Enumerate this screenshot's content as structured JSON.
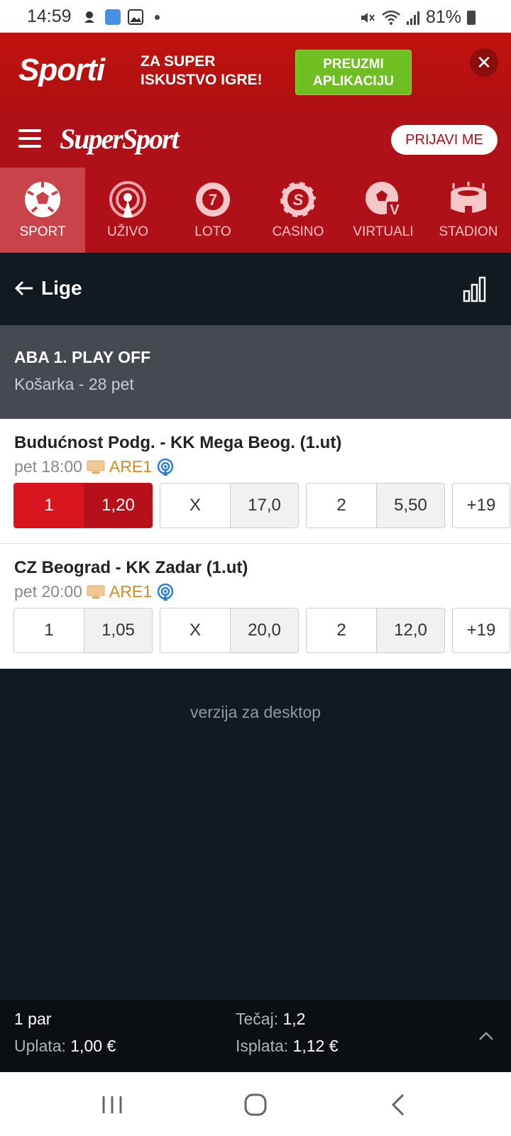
{
  "status": {
    "time": "14:59",
    "battery": "81%"
  },
  "promo": {
    "brand": "Sporti",
    "tagline": "ZA SUPER ISKUSTVO IGRE!",
    "cta": "PREUZMI APLIKACIJU",
    "close": "✕"
  },
  "header": {
    "logo": "SuperSport",
    "login": "PRIJAVI ME"
  },
  "nav": [
    {
      "label": "SPORT",
      "icon": "soccer-ball-icon"
    },
    {
      "label": "UŽIVO",
      "icon": "live-broadcast-icon"
    },
    {
      "label": "LOTO",
      "icon": "lotto-ball-icon"
    },
    {
      "label": "CASINO",
      "icon": "casino-chip-icon"
    },
    {
      "label": "VIRTUALI",
      "icon": "virtual-ball-icon"
    },
    {
      "label": "STADION",
      "icon": "stadium-icon"
    }
  ],
  "subheader": {
    "back": "Lige"
  },
  "league": {
    "name": "ABA 1. PLAY OFF",
    "sub": "Košarka - 28 pet"
  },
  "matches": [
    {
      "title": "Budućnost Podg. - KK Mega Beog. (1.ut)",
      "time": "pet 18:00",
      "channel": "ARE1",
      "odds": [
        {
          "k": "1",
          "v": "1,20",
          "selected": true
        },
        {
          "k": "X",
          "v": "17,0",
          "selected": false
        },
        {
          "k": "2",
          "v": "5,50",
          "selected": false
        }
      ],
      "more": "+19"
    },
    {
      "title": "CZ Beograd - KK Zadar (1.ut)",
      "time": "pet 20:00",
      "channel": "ARE1",
      "odds": [
        {
          "k": "1",
          "v": "1,05",
          "selected": false
        },
        {
          "k": "X",
          "v": "20,0",
          "selected": false
        },
        {
          "k": "2",
          "v": "12,0",
          "selected": false
        }
      ],
      "more": "+19"
    }
  ],
  "desktop_link": "verzija za desktop",
  "betslip": {
    "pairs": "1 par",
    "stake_label": "Uplata:",
    "stake": "1,00 €",
    "odds_label": "Tečaj:",
    "odds": "1,2",
    "payout_label": "Isplata:",
    "payout": "1,12 €"
  },
  "colors": {
    "brand_red": "#b01018",
    "selected": "#d8141e",
    "cta_green": "#6fbf22",
    "dark_bg": "#111a20"
  }
}
